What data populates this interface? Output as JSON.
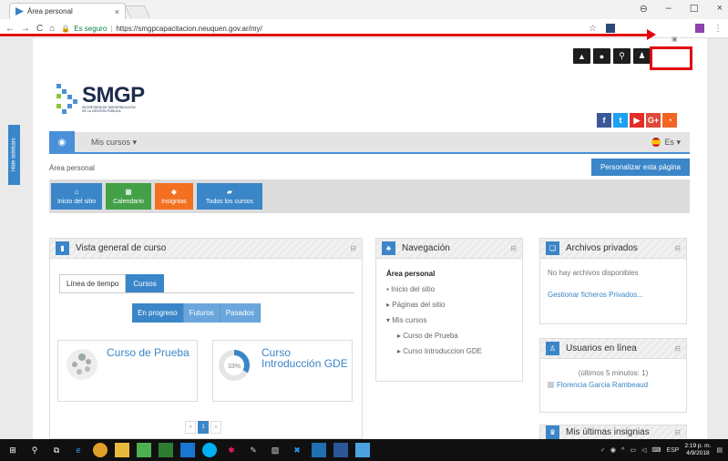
{
  "browser": {
    "tab_title": "Área personal",
    "tab_close": "×",
    "secure_label": "Es seguro",
    "url": "https://smgpcapacitacion.neuquen.gov.ar/my/",
    "win_min": "–",
    "win_max": "☐",
    "win_close": "×"
  },
  "site": {
    "logo_text": "SMGP",
    "logo_sub_1": "SECRETARÍA DE MODERNIZACIÓN",
    "logo_sub_2": "DE LA GESTIÓN PÚBLICA",
    "social": [
      "f",
      "t",
      "▶",
      "G+",
      ")"
    ],
    "social_colors": [
      "#3b5998",
      "#1da1f2",
      "#e52d27",
      "#dd4b39",
      "#f26522"
    ],
    "sidebar_toggle": "Hide sidebars",
    "nav_menu": "Mis cursos ▾",
    "lang": "Es ▾",
    "breadcrumb": "Área personal",
    "customize_button": "Personalizar esta página",
    "quick_links": [
      {
        "label": "Inicio del sitio",
        "icon": "⌂",
        "color": "#3a86c8"
      },
      {
        "label": "Calendario",
        "icon": "▦",
        "color": "#43a047"
      },
      {
        "label": "Insignias",
        "icon": "◆",
        "color": "#f37021"
      },
      {
        "label": "Todos los cursos",
        "icon": "▰",
        "color": "#3a86c8"
      }
    ]
  },
  "overview": {
    "title": "Vista general de curso",
    "tab_timeline": "Línea de tiempo",
    "tab_courses": "Cursos",
    "filter_progress": "En progreso",
    "filter_future": "Futuros",
    "filter_past": "Pasados",
    "courses": [
      {
        "title": "Curso de Prueba",
        "progress": ""
      },
      {
        "title": "Curso Introducción GDE",
        "progress": "33%"
      }
    ],
    "page_prev": "«",
    "page_current": "1",
    "page_next": "»"
  },
  "navigation": {
    "title": "Navegación",
    "items": [
      "Área personal",
      "Inicio del sitio",
      "Páginas del sitio",
      "Mis cursos",
      "Curso de Prueba",
      "Curso Introduccion GDE"
    ]
  },
  "files": {
    "title": "Archivos privados",
    "empty": "No hay archivos disponibles",
    "manage": "Gestionar ficheros Privados..."
  },
  "online": {
    "title": "Usuarios en línea",
    "info": "(últimos 5 minutos: 1)",
    "user": "Florencia Garcia Rambeaud"
  },
  "badges": {
    "title": "Mis últimas insignias"
  },
  "taskbar": {
    "lang": "ESP",
    "time": "2:19 p. m.",
    "date": "4/9/2018"
  }
}
